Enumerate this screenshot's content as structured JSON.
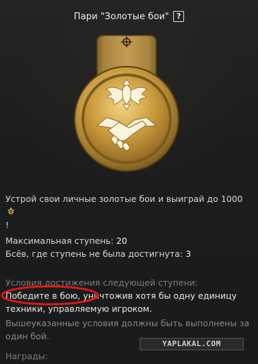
{
  "header": {
    "title": "Пари \"Золотые бои\"",
    "help_label": "?"
  },
  "medal": {
    "icon": "gold-battle-medal-icon",
    "colors": {
      "gold": "#c9a24a",
      "gold_light": "#f2d17a",
      "gold_dark": "#7a5a1c"
    }
  },
  "description": {
    "text": "Устрой свои личные золотые бои и выиграй до 1000",
    "currency_icon": "gold-eagle-icon",
    "suffix": "!"
  },
  "stats": {
    "max_stage_label": "Максимальная ступень: ",
    "max_stage_value": "20",
    "battles_label": "Бсёв, где ступень не была достигнута: ",
    "battles_value": "3"
  },
  "conditions": {
    "label": "Условия достижения следующей ступени:",
    "main": "Победите в бою, уничтожив хотя бы одну единицу техники, управляемую игроком.",
    "note": "Вышеуказанные условия должны быть выполнены за один бой."
  },
  "rewards": {
    "label": "Награды:"
  },
  "watermark": {
    "text": "YAPLAKAL.COM"
  },
  "annotation": {
    "color": "#e01818"
  }
}
